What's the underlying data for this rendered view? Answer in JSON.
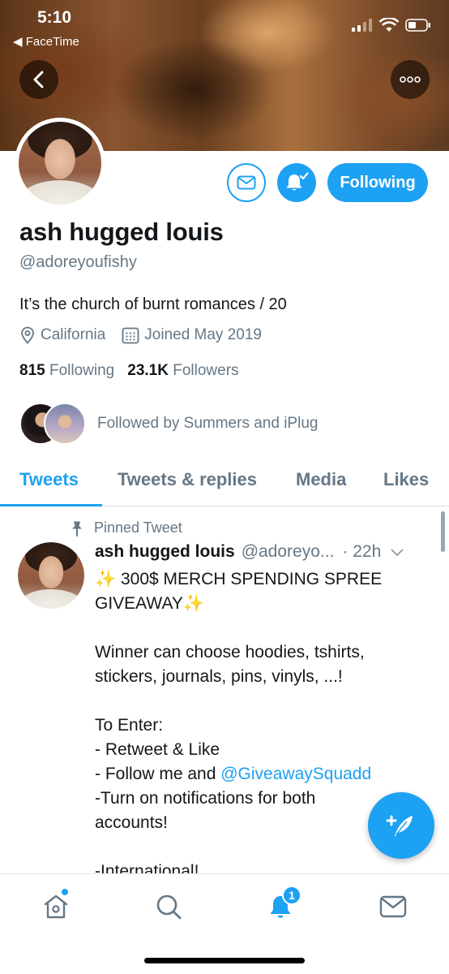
{
  "status_bar": {
    "time": "5:10",
    "back_label": "FaceTime"
  },
  "profile": {
    "display_name": "ash hugged louis",
    "handle": "@adoreyoufishy",
    "bio": "It’s the church of burnt romances / 20",
    "location": "California",
    "joined": "Joined May 2019",
    "following_count": "815",
    "following_label": "Following",
    "followers_count": "23.1K",
    "followers_label": "Followers",
    "followed_by": "Followed by Summers and iPlug",
    "follow_button_label": "Following"
  },
  "tabs": [
    "Tweets",
    "Tweets & replies",
    "Media",
    "Likes"
  ],
  "active_tab": "Tweets",
  "tweet": {
    "pinned_label": "Pinned Tweet",
    "author_name": "ash hugged louis",
    "author_handle": "@adoreyo...",
    "time": "· 22h",
    "line1_text": "300$ MERCH SPENDING SPREE",
    "line2_text": "GIVEAWAY",
    "line3": "Winner can choose hoodies, tshirts,",
    "line4": "stickers, journals, pins, vinyls, ...!",
    "line5": "To Enter:",
    "line6": "- Retweet & Like",
    "line7_prefix": "- Follow me and ",
    "line7_mention": "@GiveawaySquadd",
    "line8": "-Turn on notifications for both",
    "line9": "accounts!",
    "line10": "-International!"
  },
  "tab_bar": {
    "notification_count": "1"
  },
  "colors": {
    "accent": "#1da1f2",
    "secondary_text": "#657786",
    "primary_text": "#14171a"
  },
  "icons": {
    "back": "back-arrow-icon",
    "more": "more-dots-icon",
    "message": "envelope-icon",
    "notifications": "bell-check-icon",
    "location": "location-pin-icon",
    "calendar": "calendar-icon",
    "pin": "pushpin-icon",
    "compose": "compose-quill-icon",
    "home": "home-icon",
    "search": "search-icon",
    "bell": "bell-icon",
    "mail": "mail-icon"
  }
}
